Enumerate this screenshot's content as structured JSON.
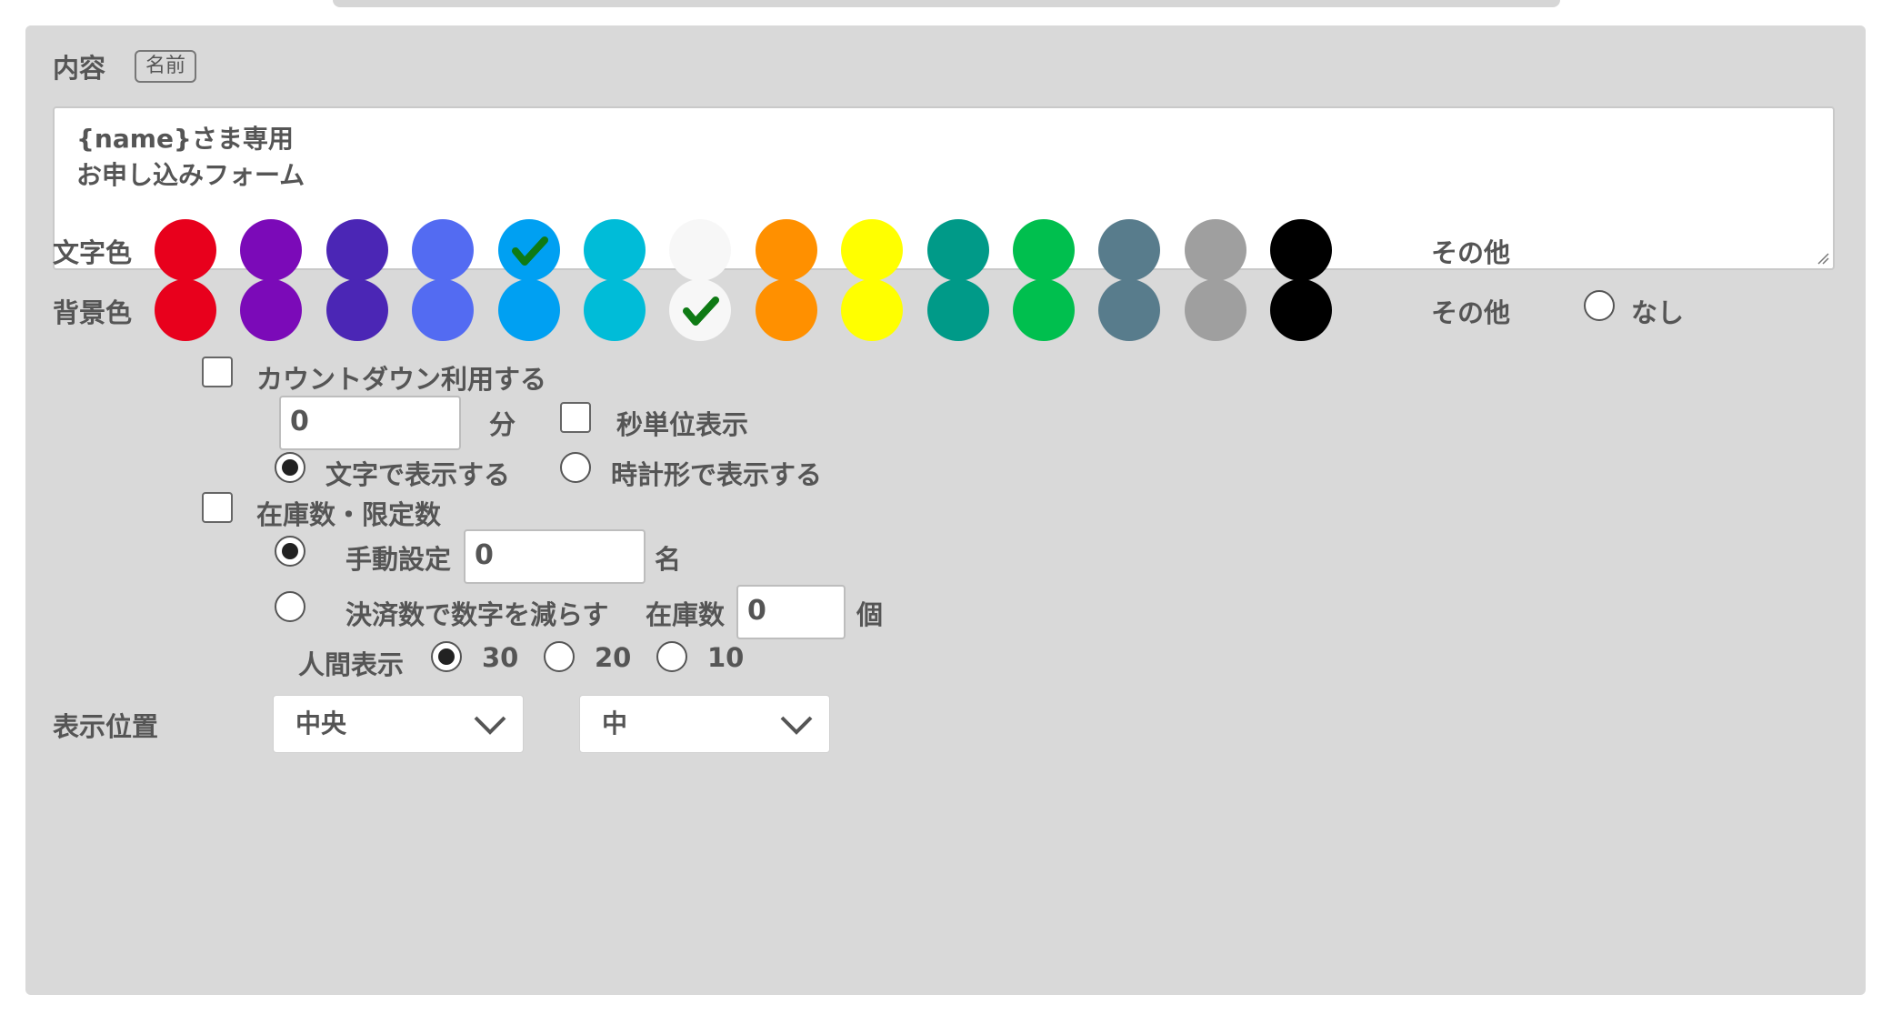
{
  "content": {
    "label": "内容",
    "badge": "名前",
    "text_lines": [
      "{name}さま専用",
      "お申し込みフォーム"
    ]
  },
  "text_color": {
    "label": "文字色",
    "other_label": "その他",
    "selected_index": 4
  },
  "bg_color": {
    "label": "背景色",
    "other_label": "その他",
    "none_label": "なし",
    "selected_index": 6
  },
  "swatches": [
    "#e8001c",
    "#7b0ab8",
    "#4b26b5",
    "#536bf2",
    "#00a0f2",
    "#00bcd8",
    "#f7f7f7",
    "#ff9000",
    "#ffff00",
    "#009a88",
    "#00bf4e",
    "#587c8c",
    "#9f9f9f",
    "#000000"
  ],
  "check_color": "#0e7a14",
  "countdown": {
    "label": "カウントダウン利用する",
    "minutes_value": "0",
    "minutes_unit": "分",
    "seconds_label": "秒単位表示",
    "display_text_label": "文字で表示する",
    "display_clock_label": "時計形で表示する"
  },
  "stock": {
    "label": "在庫数・限定数",
    "manual_label": "手動設定",
    "manual_value": "0",
    "manual_unit": "名",
    "payment_label": "決済数で数字を減らす",
    "stock_label": "在庫数",
    "stock_value": "0",
    "stock_unit": "個",
    "human_label": "人間表示",
    "options": [
      "30",
      "20",
      "10"
    ],
    "selected_option": "30"
  },
  "position": {
    "label": "表示位置",
    "horizontal": "中央",
    "size": "中"
  }
}
